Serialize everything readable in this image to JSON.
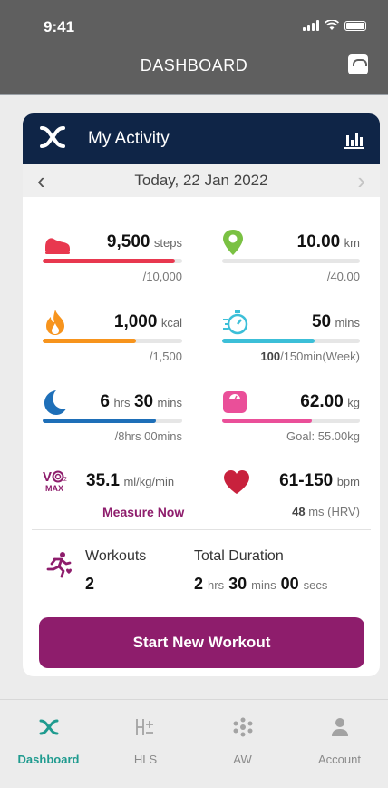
{
  "status": {
    "time": "9:41"
  },
  "header": {
    "title": "DASHBOARD"
  },
  "card": {
    "title": "My Activity",
    "date": "Today, 22 Jan 2022"
  },
  "metrics": {
    "steps": {
      "value": "9,500",
      "unit": "steps",
      "goal": "/10,000",
      "progress": 0.95,
      "color": "#e8384f"
    },
    "distance": {
      "value": "10.00",
      "unit": "km",
      "goal": "/40.00",
      "progress": 0.0,
      "color": "#7ac143"
    },
    "calories": {
      "value": "1,000",
      "unit": "kcal",
      "goal": "/1,500",
      "progress": 0.67,
      "color": "#f7941d"
    },
    "active": {
      "value": "50",
      "unit": "mins",
      "goal_bold": "100",
      "goal_rest": "/150min(Week)",
      "progress": 0.67,
      "color": "#3cbfd8"
    },
    "sleep": {
      "hours": "6",
      "hours_unit": "hrs",
      "mins": "30",
      "mins_unit": "mins",
      "goal": "/8hrs 00mins",
      "progress": 0.81,
      "color": "#1e6fb8"
    },
    "weight": {
      "value": "62.00",
      "unit": "kg",
      "goal": "Goal: 55.00kg",
      "progress": 0.65,
      "color": "#ea4f99"
    },
    "vo2": {
      "value": "35.1",
      "unit": "ml/kg/min",
      "action": "Measure Now",
      "color": "#8e1d6c"
    },
    "heart": {
      "value": "61-150",
      "unit": "bpm",
      "hrv_value": "48",
      "hrv_unit": "ms (HRV)",
      "color": "#c8213d"
    }
  },
  "workouts": {
    "label": "Workouts",
    "count": "2",
    "duration_label": "Total Duration",
    "hours": "2",
    "hours_unit": "hrs",
    "mins": "30",
    "mins_unit": "mins",
    "secs": "00",
    "secs_unit": "secs"
  },
  "start_button": "Start New Workout",
  "nav": [
    {
      "label": "Dashboard",
      "icon": "x-logo-icon",
      "active": true
    },
    {
      "label": "HLS",
      "icon": "hls-icon",
      "active": false
    },
    {
      "label": "AW",
      "icon": "aw-icon",
      "active": false
    },
    {
      "label": "Account",
      "icon": "person-icon",
      "active": false
    }
  ],
  "colors": {
    "header_bg": "#5f5f5f",
    "card_head_bg": "#0f2547",
    "accent": "#8e1d6c",
    "nav_active": "#1f9b8f"
  }
}
